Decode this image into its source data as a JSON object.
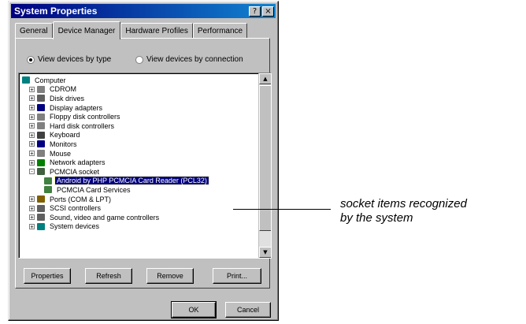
{
  "window": {
    "title": "System Properties",
    "help_btn": "?",
    "close_btn": "×"
  },
  "tabs": [
    {
      "label": "General",
      "active": false
    },
    {
      "label": "Device Manager",
      "active": true
    },
    {
      "label": "Hardware Profiles",
      "active": false
    },
    {
      "label": "Performance",
      "active": false
    }
  ],
  "view_options": {
    "by_type": {
      "label": "View devices by type",
      "selected": true
    },
    "by_connection": {
      "label": "View devices by connection",
      "selected": false
    }
  },
  "device_tree": [
    {
      "label": "Computer",
      "icon": "computer-icon",
      "expander": "",
      "indent": 0
    },
    {
      "label": "CDROM",
      "icon": "cdrom-icon",
      "expander": "+",
      "indent": 1
    },
    {
      "label": "Disk drives",
      "icon": "disk-drive-icon",
      "expander": "+",
      "indent": 1
    },
    {
      "label": "Display adapters",
      "icon": "display-adapter-icon",
      "expander": "+",
      "indent": 1
    },
    {
      "label": "Floppy disk controllers",
      "icon": "floppy-controller-icon",
      "expander": "+",
      "indent": 1
    },
    {
      "label": "Hard disk controllers",
      "icon": "hard-disk-controller-icon",
      "expander": "+",
      "indent": 1
    },
    {
      "label": "Keyboard",
      "icon": "keyboard-icon",
      "expander": "+",
      "indent": 1
    },
    {
      "label": "Monitors",
      "icon": "monitor-icon",
      "expander": "+",
      "indent": 1
    },
    {
      "label": "Mouse",
      "icon": "mouse-icon",
      "expander": "+",
      "indent": 1
    },
    {
      "label": "Network adapters",
      "icon": "network-adapter-icon",
      "expander": "+",
      "indent": 1
    },
    {
      "label": "PCMCIA socket",
      "icon": "pcmcia-socket-icon",
      "expander": "-",
      "indent": 1
    },
    {
      "label": "Android by PHP PCMCIA Card Reader (PCL32)",
      "icon": "pcmcia-device-icon",
      "expander": "",
      "indent": 2,
      "selected": true
    },
    {
      "label": "PCMCIA Card Services",
      "icon": "pcmcia-device-icon",
      "expander": "",
      "indent": 2
    },
    {
      "label": "Ports (COM & LPT)",
      "icon": "ports-icon",
      "expander": "+",
      "indent": 1
    },
    {
      "label": "SCSI controllers",
      "icon": "scsi-controller-icon",
      "expander": "+",
      "indent": 1
    },
    {
      "label": "Sound, video and game controllers",
      "icon": "sound-controller-icon",
      "expander": "+",
      "indent": 1
    },
    {
      "label": "System devices",
      "icon": "system-devices-icon",
      "expander": "+",
      "indent": 1
    }
  ],
  "scrollbar": {
    "up": "▲",
    "down": "▼"
  },
  "buttons": {
    "properties": "Properties",
    "refresh": "Refresh",
    "remove": "Remove",
    "print": "Print...",
    "ok": "OK",
    "cancel": "Cancel"
  },
  "annotation": {
    "line1": "socket items recognized",
    "line2": "by the system"
  },
  "colors": {
    "titlebar": "#000080",
    "selection": "#000080",
    "face": "#c0c0c0"
  }
}
